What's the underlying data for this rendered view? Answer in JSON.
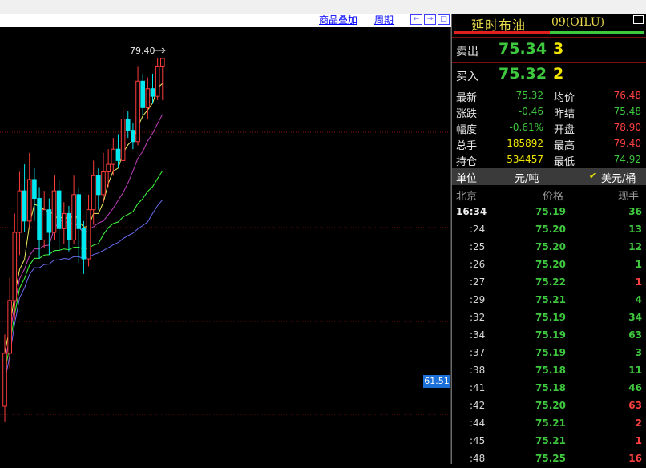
{
  "toolbar": {
    "overlay_label": "商品叠加",
    "period_label": "周期"
  },
  "chart": {
    "peak_label": "79.40",
    "price_tag": "61.51",
    "candles": [
      {
        "o": 70.2,
        "c": 71.6,
        "h": 72.1,
        "l": 69.8
      },
      {
        "o": 71.6,
        "c": 73.0,
        "h": 73.6,
        "l": 71.2
      },
      {
        "o": 73.0,
        "c": 74.8,
        "h": 75.3,
        "l": 72.5
      },
      {
        "o": 74.8,
        "c": 75.9,
        "h": 76.4,
        "l": 74.2
      },
      {
        "o": 75.9,
        "c": 75.1,
        "h": 76.6,
        "l": 74.8
      },
      {
        "o": 75.1,
        "c": 76.2,
        "h": 76.9,
        "l": 74.9
      },
      {
        "o": 76.2,
        "c": 75.7,
        "h": 76.5,
        "l": 75.1
      },
      {
        "o": 75.7,
        "c": 74.6,
        "h": 76.0,
        "l": 74.1
      },
      {
        "o": 74.6,
        "c": 75.4,
        "h": 75.9,
        "l": 74.4
      },
      {
        "o": 75.4,
        "c": 74.8,
        "h": 75.7,
        "l": 74.2
      },
      {
        "o": 74.8,
        "c": 75.9,
        "h": 76.3,
        "l": 74.6
      },
      {
        "o": 75.9,
        "c": 74.9,
        "h": 76.2,
        "l": 74.3
      },
      {
        "o": 74.9,
        "c": 75.3,
        "h": 75.6,
        "l": 74.5
      },
      {
        "o": 75.3,
        "c": 74.6,
        "h": 75.5,
        "l": 74.3
      },
      {
        "o": 74.6,
        "c": 75.8,
        "h": 76.3,
        "l": 74.5
      },
      {
        "o": 75.8,
        "c": 74.9,
        "h": 76.0,
        "l": 74.0
      },
      {
        "o": 74.9,
        "c": 74.1,
        "h": 75.1,
        "l": 73.7
      },
      {
        "o": 74.1,
        "c": 75.4,
        "h": 75.8,
        "l": 73.9
      },
      {
        "o": 75.4,
        "c": 76.3,
        "h": 76.7,
        "l": 75.0
      },
      {
        "o": 76.3,
        "c": 75.8,
        "h": 76.5,
        "l": 75.4
      },
      {
        "o": 75.8,
        "c": 76.4,
        "h": 76.9,
        "l": 75.6
      },
      {
        "o": 76.4,
        "c": 76.6,
        "h": 77.0,
        "l": 76.0
      },
      {
        "o": 76.6,
        "c": 77.0,
        "h": 77.3,
        "l": 76.3
      },
      {
        "o": 77.0,
        "c": 76.7,
        "h": 77.4,
        "l": 76.5
      },
      {
        "o": 76.7,
        "c": 77.8,
        "h": 78.1,
        "l": 76.5
      },
      {
        "o": 77.8,
        "c": 77.5,
        "h": 78.0,
        "l": 77.3
      },
      {
        "o": 77.5,
        "c": 77.2,
        "h": 77.7,
        "l": 77.0
      },
      {
        "o": 77.2,
        "c": 78.8,
        "h": 79.2,
        "l": 77.1
      },
      {
        "o": 78.8,
        "c": 78.1,
        "h": 79.0,
        "l": 77.9
      },
      {
        "o": 78.1,
        "c": 78.6,
        "h": 78.9,
        "l": 77.8
      },
      {
        "o": 78.6,
        "c": 78.4,
        "h": 79.0,
        "l": 78.2
      },
      {
        "o": 78.4,
        "c": 79.2,
        "h": 79.4,
        "l": 78.3
      },
      {
        "o": 79.2,
        "c": 79.4,
        "h": 79.4,
        "l": 78.3
      }
    ]
  },
  "quote": {
    "name": "延时布油",
    "code": "09(OILU)",
    "sell_label": "卖出",
    "sell_price": "75.34",
    "sell_vol": "3",
    "buy_label": "买入",
    "buy_price": "75.32",
    "buy_vol": "2",
    "stats": [
      {
        "l1": "最新",
        "v1": "75.32",
        "c1": "#3ec83e",
        "l2": "均价",
        "v2": "76.48",
        "c2": "#ff4040"
      },
      {
        "l1": "涨跌",
        "v1": "-0.46",
        "c1": "#3ec83e",
        "l2": "昨结",
        "v2": "75.48",
        "c2": "#3ec83e"
      },
      {
        "l1": "幅度",
        "v1": "-0.61%",
        "c1": "#3ec83e",
        "l2": "开盘",
        "v2": "78.90",
        "c2": "#ff4040"
      },
      {
        "l1": "总手",
        "v1": "185892",
        "c1": "#f2e600",
        "l2": "最高",
        "v2": "79.40",
        "c2": "#ff4040"
      },
      {
        "l1": "持仓",
        "v1": "534457",
        "c1": "#f2e600",
        "l2": "最低",
        "v2": "74.92",
        "c2": "#3ec83e"
      }
    ],
    "unit_label": "单位",
    "unit_value": "元/吨",
    "unit_alt": "美元/桶",
    "tick_headers": {
      "time": "北京",
      "price": "价格",
      "vol": "现手"
    },
    "ticks": [
      {
        "t": "16:34",
        "p": "75.19",
        "v": "36",
        "vc": "#3ec83e",
        "full": true
      },
      {
        "t": ":24",
        "p": "75.20",
        "v": "13",
        "vc": "#3ec83e"
      },
      {
        "t": ":25",
        "p": "75.20",
        "v": "12",
        "vc": "#3ec83e"
      },
      {
        "t": ":26",
        "p": "75.20",
        "v": "1",
        "vc": "#3ec83e"
      },
      {
        "t": ":27",
        "p": "75.22",
        "v": "1",
        "vc": "#ff4040"
      },
      {
        "t": ":29",
        "p": "75.21",
        "v": "4",
        "vc": "#3ec83e"
      },
      {
        "t": ":32",
        "p": "75.19",
        "v": "34",
        "vc": "#3ec83e"
      },
      {
        "t": ":34",
        "p": "75.19",
        "v": "63",
        "vc": "#3ec83e"
      },
      {
        "t": ":37",
        "p": "75.19",
        "v": "3",
        "vc": "#3ec83e"
      },
      {
        "t": ":38",
        "p": "75.18",
        "v": "11",
        "vc": "#3ec83e"
      },
      {
        "t": ":41",
        "p": "75.18",
        "v": "46",
        "vc": "#3ec83e"
      },
      {
        "t": ":42",
        "p": "75.20",
        "v": "63",
        "vc": "#ff4040"
      },
      {
        "t": ":44",
        "p": "75.21",
        "v": "2",
        "vc": "#ff4040"
      },
      {
        "t": ":45",
        "p": "75.21",
        "v": "1",
        "vc": "#ff4040"
      },
      {
        "t": ":48",
        "p": "75.25",
        "v": "16",
        "vc": "#ff4040"
      }
    ]
  }
}
